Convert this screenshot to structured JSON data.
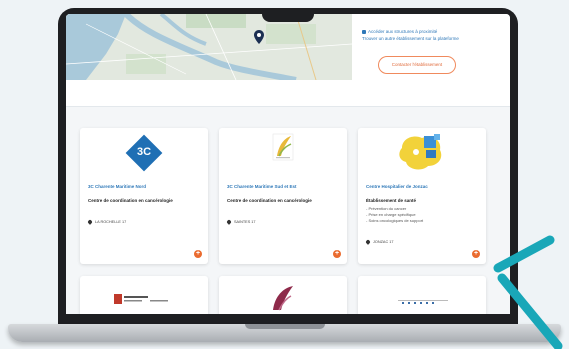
{
  "side_links": {
    "link1": "Accéder aux structures à proximité",
    "link2": "Trouver un autre établissement sur la plateforme"
  },
  "contact_button": "Contacter l'établissement",
  "cards": [
    {
      "logo_text": "3C",
      "title": "3C Charente Maritime Nord",
      "type": "Centre de coordination en cancérologie",
      "items": [],
      "location": "LA ROCHELLE 17"
    },
    {
      "logo_text": "",
      "title": "3C Charente Maritime Sud et Est",
      "type": "Centre de coordination en cancérologie",
      "items": [],
      "location": "SAINTES 17"
    },
    {
      "logo_text": "",
      "title": "Centre Hospitalier de Jonzac",
      "type": "Établissement de santé",
      "items": [
        "- Prévention du cancer",
        "- Prise en charge spécifique",
        "- Soins oncologiques de support"
      ],
      "location": "JONZAC 17"
    }
  ],
  "icons": {
    "map_marker": "map-pin-icon",
    "location": "location-pin-icon",
    "add": "plus-circle-icon"
  },
  "colors": {
    "link_blue": "#2e78b8",
    "accent_orange": "#ea6b2f",
    "logo_blue": "#1f6fb4",
    "accent_teal": "#19a7b8"
  }
}
